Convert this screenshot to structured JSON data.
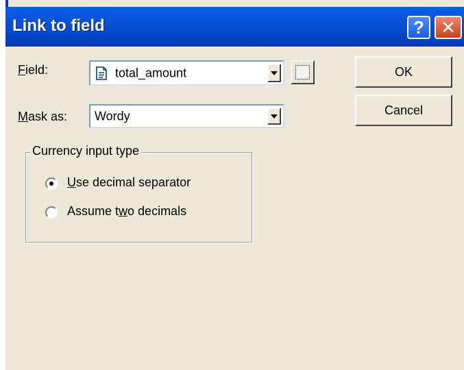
{
  "window": {
    "title": "Link to field",
    "help_icon": "help-icon",
    "close_icon": "close-icon"
  },
  "field": {
    "label_prefix": "",
    "label_accel": "F",
    "label_rest": "ield:",
    "value": "total_amount",
    "value_icon": "field-document-icon",
    "picker_icon": "field-picker-icon"
  },
  "mask": {
    "label_accel": "M",
    "label_rest": "ask as:",
    "value": "Wordy"
  },
  "buttons": {
    "ok": "OK",
    "cancel": "Cancel"
  },
  "currency_group": {
    "title": "Currency input type",
    "options": [
      {
        "accel": "U",
        "pre": "",
        "post": "se decimal separator",
        "selected": true
      },
      {
        "accel": "w",
        "pre": "Assume t",
        "post": "o decimals",
        "selected": false
      }
    ]
  }
}
